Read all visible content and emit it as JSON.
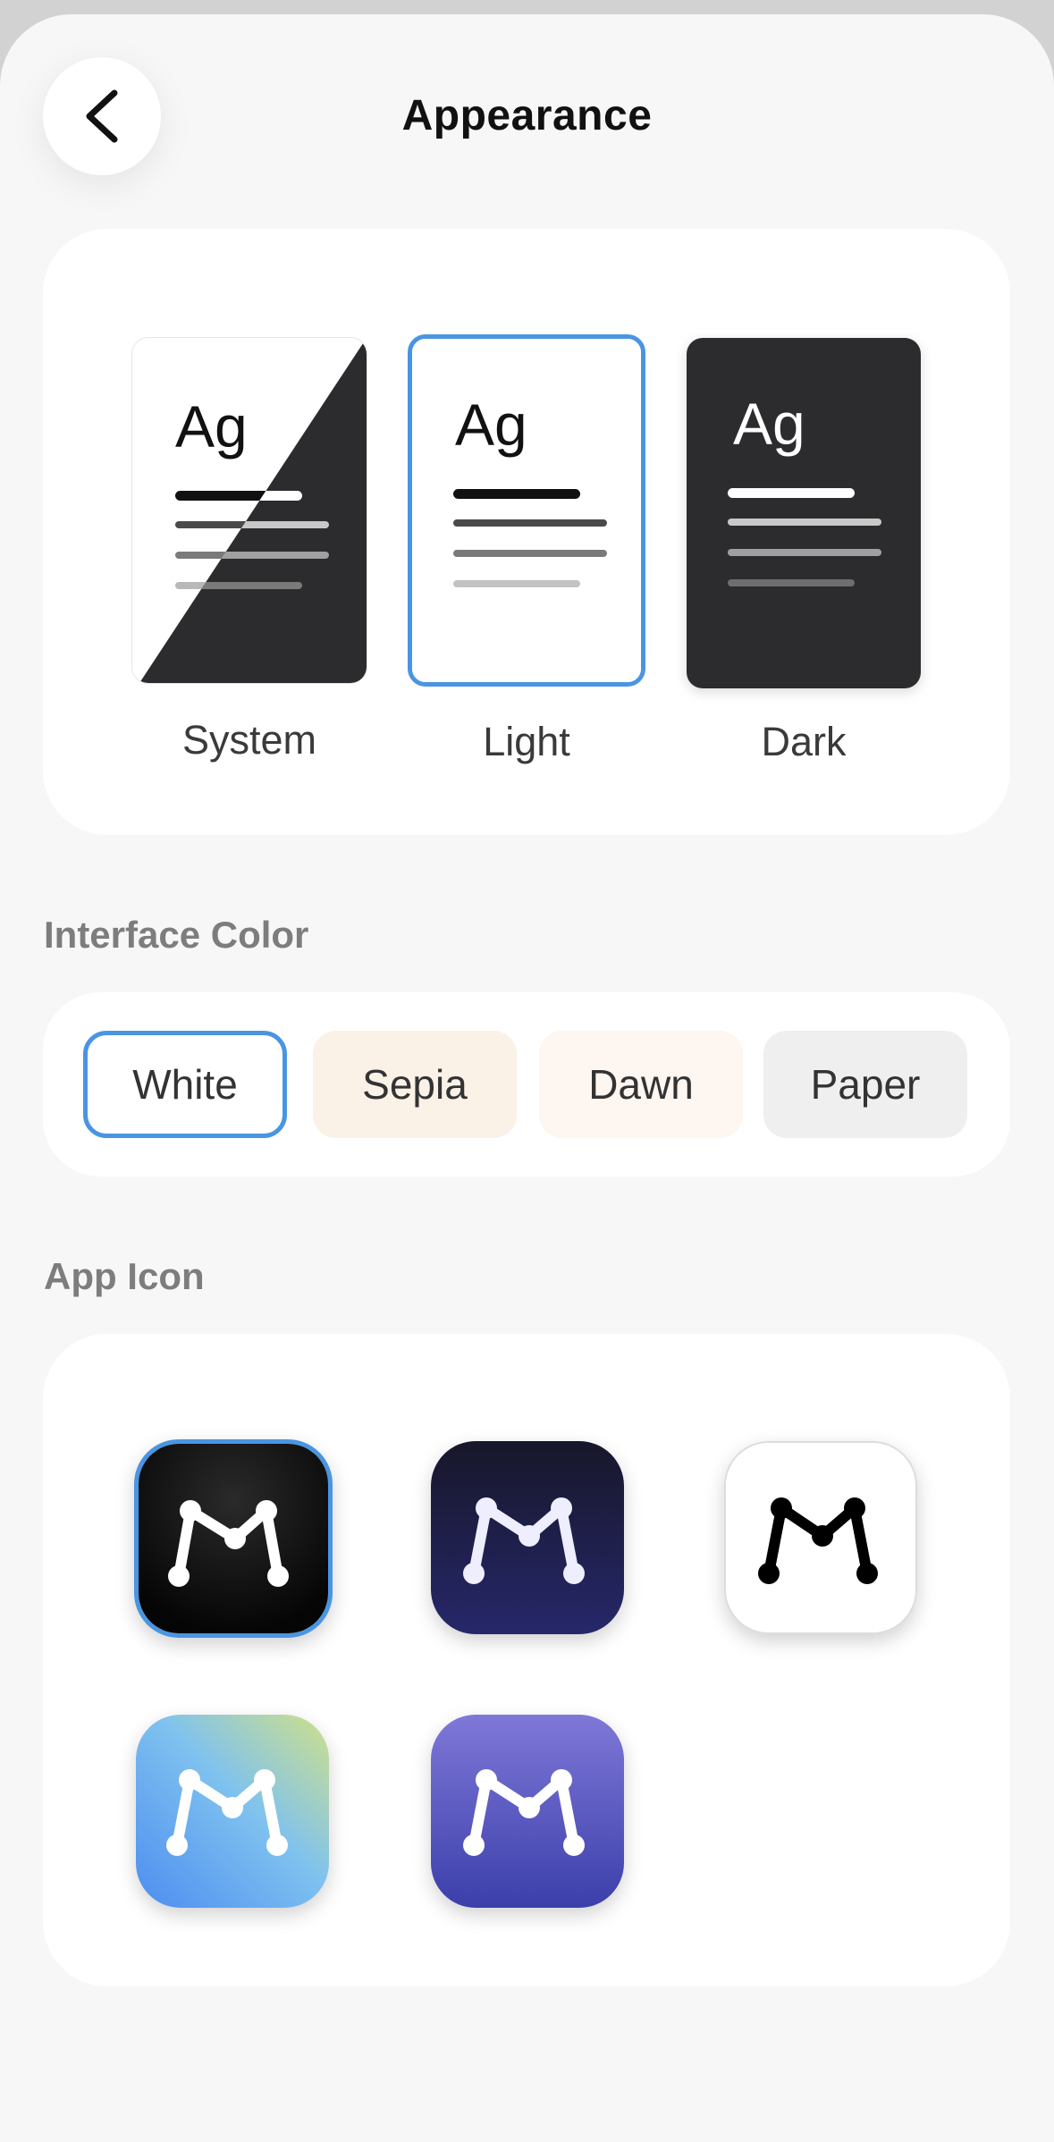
{
  "header": {
    "title": "Appearance",
    "back_icon": "chevron-left-icon"
  },
  "appearance_modes": [
    {
      "label": "System",
      "selected": false
    },
    {
      "label": "Light",
      "selected": true
    },
    {
      "label": "Dark",
      "selected": false
    }
  ],
  "interface_color": {
    "section_label": "Interface Color",
    "options": [
      {
        "label": "White",
        "bg": "#ffffff",
        "selected": true
      },
      {
        "label": "Sepia",
        "bg": "#faf1e7",
        "selected": false
      },
      {
        "label": "Dawn",
        "bg": "#fdf6f1",
        "selected": false
      },
      {
        "label": "Paper",
        "bg": "#efefef",
        "selected": false
      }
    ]
  },
  "app_icon": {
    "section_label": "App Icon",
    "icons": [
      {
        "name": "black-icon",
        "selected": true
      },
      {
        "name": "midnight-icon",
        "selected": false
      },
      {
        "name": "white-icon",
        "selected": false
      },
      {
        "name": "gradient-icon",
        "selected": false
      },
      {
        "name": "indigo-icon",
        "selected": false
      }
    ]
  },
  "colors": {
    "accent": "#4a95e2",
    "background": "#f7f7f7",
    "card": "#ffffff",
    "dark": "#2c2c2e"
  },
  "thumb_text": "Ag"
}
